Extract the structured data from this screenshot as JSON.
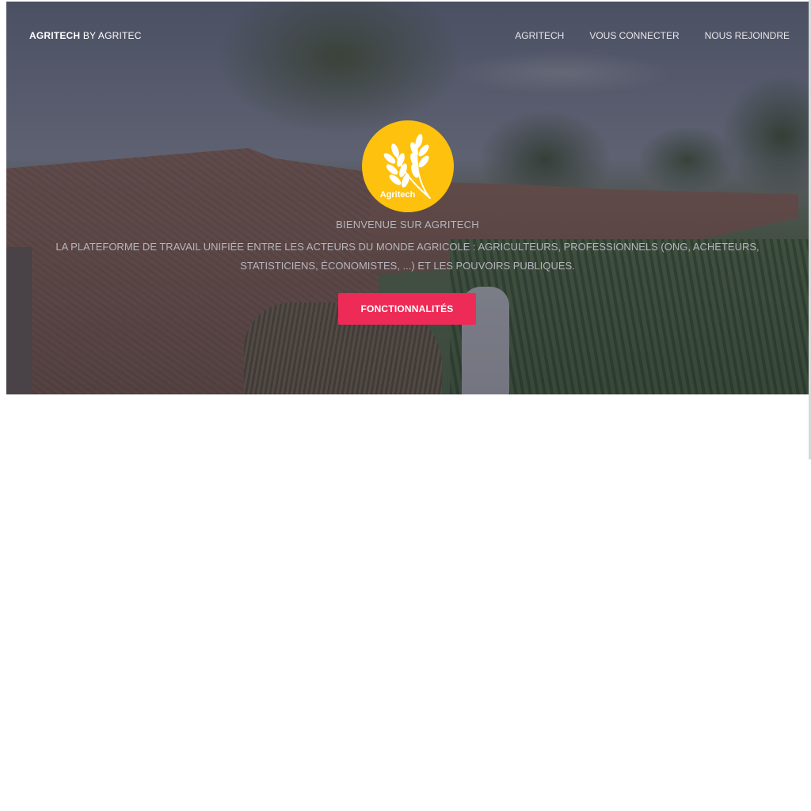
{
  "navbar": {
    "brand_bold": "AGRITECH",
    "brand_rest": " BY AGRITEC",
    "links": [
      {
        "label": "AGRITECH"
      },
      {
        "label": "VOUS CONNECTER"
      },
      {
        "label": "NOUS REJOINDRE"
      }
    ]
  },
  "hero": {
    "logo_text": "Agritech",
    "headline": "BIENVENUE SUR AGRITECH",
    "subtitle": "LA PLATEFORME DE TRAVAIL UNIFIÉE ENTRE LES ACTEURS DU MONDE AGRICOLE : AGRICULTEURS, PROFESSIONNELS (ONG, ACHETEURS, STATISTICIENS, ÉCONOMISTES, ...) ET LES POUVOIRS PUBLIQUES.",
    "cta_label": "FONCTIONNALITÉS"
  },
  "colors": {
    "logo_yellow": "#fec10d",
    "cta_red": "#ee2a56",
    "overlay": "#2d2d3c"
  },
  "icons": {
    "logo": "wheat-icon"
  }
}
